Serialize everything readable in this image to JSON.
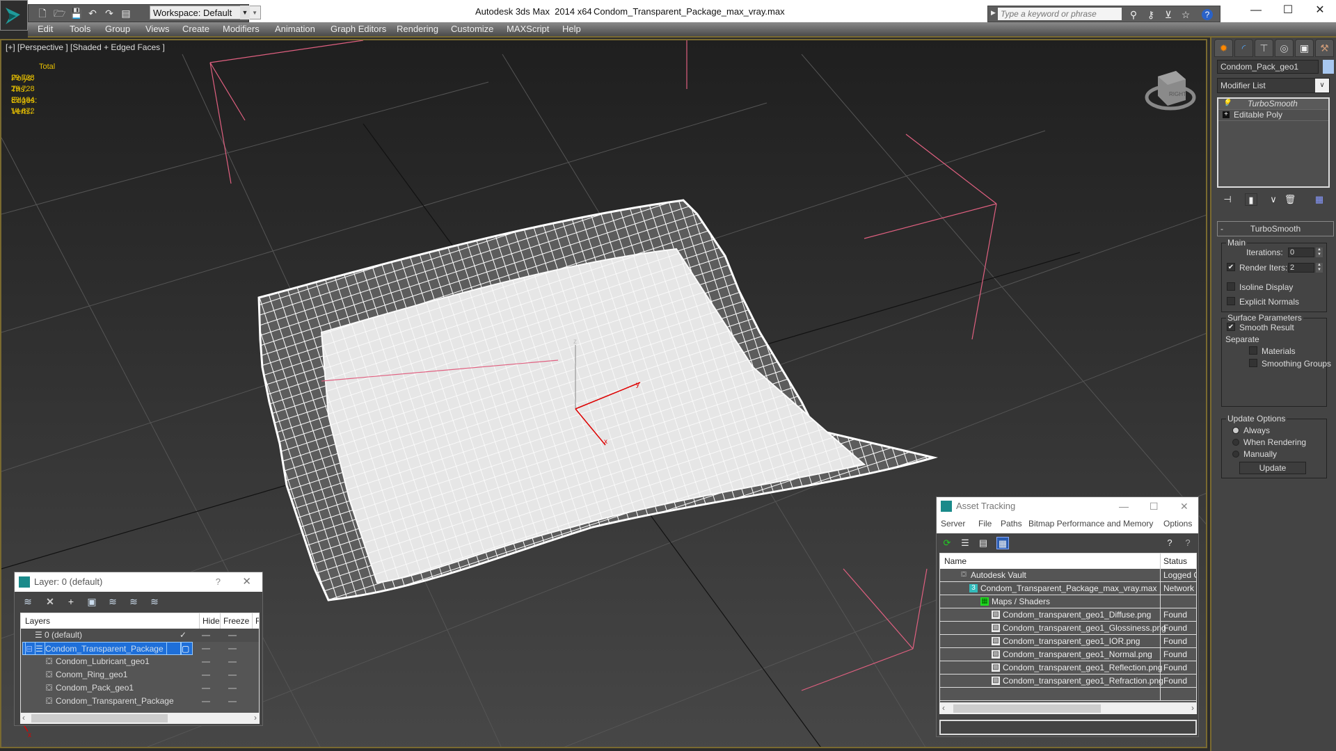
{
  "titlebar": {
    "app_title": "Autodesk 3ds Max  2014 x64",
    "file_name": "Condom_Transparent_Package_max_vray.max",
    "workspace": "Workspace: Default",
    "search_placeholder": "Type a keyword or phrase",
    "window_controls": [
      "minimize",
      "maximize",
      "close"
    ]
  },
  "menu": [
    "Edit",
    "Tools",
    "Group",
    "Views",
    "Create",
    "Modifiers",
    "Animation",
    "Graph Editors",
    "Rendering",
    "Customize",
    "MAXScript",
    "Help"
  ],
  "viewport": {
    "label": "[+] [Perspective ] [Shaded + Edged Faces ]",
    "stats": {
      "header": "Total",
      "rows": [
        {
          "label": "Polys:",
          "value": "29 728"
        },
        {
          "label": "Tris:",
          "value": "29 728"
        },
        {
          "label": "Edges:",
          "value": "89 184"
        },
        {
          "label": "Verts:",
          "value": "14 872"
        }
      ]
    },
    "axis_labels": {
      "x": "x",
      "y": "y",
      "z": "z"
    },
    "viewcube_label": "RIGHT"
  },
  "command_panel": {
    "object_name": "Condom_Pack_geo1",
    "object_color": "#a8c8f0",
    "modifier_list": "Modifier List",
    "stack": [
      {
        "label": "TurboSmooth",
        "icon": "lightbulb-icon"
      },
      {
        "label": "Editable Poly",
        "icon": "plus-icon"
      }
    ],
    "rollout": {
      "title": "TurboSmooth",
      "collapse": "-",
      "main_group": "Main",
      "iterations_label": "Iterations:",
      "iterations": "0",
      "render_iters_label": "Render Iters:",
      "render_iters": "2",
      "render_iters_checked": true,
      "isoline_display": "Isoline Display",
      "explicit_normals": "Explicit Normals",
      "surface_group": "Surface Parameters",
      "smooth_result": "Smooth Result",
      "separate": "Separate",
      "materials": "Materials",
      "smoothing_groups": "Smoothing Groups",
      "update_group": "Update Options",
      "always": "Always",
      "when_rendering": "When Rendering",
      "manually": "Manually",
      "update_button": "Update"
    }
  },
  "layer_window": {
    "title": "Layer: 0 (default)",
    "help": "?",
    "columns": [
      "Layers",
      "Hide",
      "Freeze",
      "Re"
    ],
    "rows": [
      {
        "name": "0 (default)",
        "level": 0,
        "type": "layer",
        "current": true
      },
      {
        "name": "Condom_Transparent_Package",
        "level": 0,
        "type": "layer",
        "selected": true,
        "expanded": true
      },
      {
        "name": "Condom_Lubricant_geo1",
        "level": 1,
        "type": "object"
      },
      {
        "name": "Conom_Ring_geo1",
        "level": 1,
        "type": "object"
      },
      {
        "name": "Condom_Pack_geo1",
        "level": 1,
        "type": "object"
      },
      {
        "name": "Condom_Transparent_Package",
        "level": 1,
        "type": "object"
      }
    ]
  },
  "asset_window": {
    "title": "Asset Tracking",
    "menu": [
      "Server",
      "File",
      "Paths",
      "Bitmap Performance and Memory",
      "Options"
    ],
    "columns": [
      "Name",
      "Status"
    ],
    "rows": [
      {
        "name": "Autodesk Vault",
        "status": "Logged Out",
        "level": 0,
        "icon": "vault-icon"
      },
      {
        "name": "Condom_Transparent_Package_max_vray.max",
        "status": "Network",
        "level": 1,
        "icon": "max-file-icon"
      },
      {
        "name": "Maps / Shaders",
        "status": "",
        "level": 2,
        "icon": "maps-icon"
      },
      {
        "name": "Condom_transparent_geo1_Diffuse.png",
        "status": "Found",
        "level": 3,
        "icon": "bitmap-icon"
      },
      {
        "name": "Condom_transparent_geo1_Glossiness.png",
        "status": "Found",
        "level": 3,
        "icon": "bitmap-icon"
      },
      {
        "name": "Condom_transparent_geo1_IOR.png",
        "status": "Found",
        "level": 3,
        "icon": "bitmap-icon"
      },
      {
        "name": "Condom_transparent_geo1_Normal.png",
        "status": "Found",
        "level": 3,
        "icon": "bitmap-icon"
      },
      {
        "name": "Condom_transparent_geo1_Reflection.png",
        "status": "Found",
        "level": 3,
        "icon": "bitmap-icon"
      },
      {
        "name": "Condom_transparent_geo1_Refraction.png",
        "status": "Found",
        "level": 3,
        "icon": "bitmap-icon"
      }
    ]
  }
}
